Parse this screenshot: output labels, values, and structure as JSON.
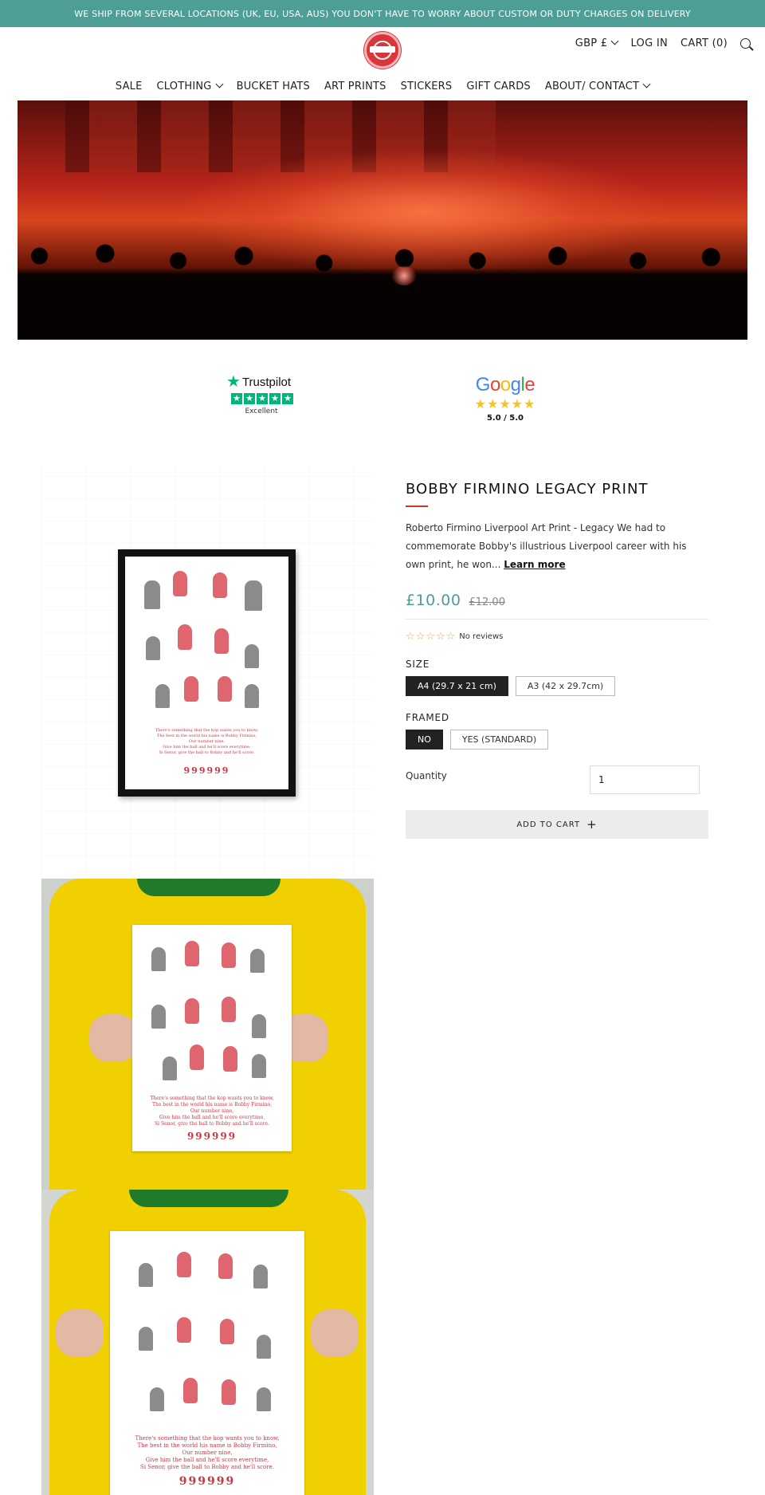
{
  "announcement": "WE SHIP FROM SEVERAL LOCATIONS (UK, EU, USA, AUS) YOU DON'T HAVE TO WORRY ABOUT CUSTOM OR DUTY CHARGES ON DELIVERY",
  "header": {
    "currency": "GBP £",
    "login": "LOG IN",
    "cart": "CART (0)"
  },
  "nav": {
    "items": [
      {
        "label": "SALE",
        "dropdown": false
      },
      {
        "label": "CLOTHING",
        "dropdown": true
      },
      {
        "label": "BUCKET HATS",
        "dropdown": false
      },
      {
        "label": "ART PRINTS",
        "dropdown": false
      },
      {
        "label": "STICKERS",
        "dropdown": false
      },
      {
        "label": "GIFT CARDS",
        "dropdown": false
      },
      {
        "label": "ABOUT/ CONTACT",
        "dropdown": true
      }
    ]
  },
  "badges": {
    "trustpilot": {
      "name": "Trustpilot",
      "rating_text": "Excellent",
      "stars": 5
    },
    "google": {
      "name": "Google",
      "score": "5.0 / 5.0",
      "stars": 5
    }
  },
  "gallery": {
    "poster_number": "999999",
    "poster_lines": [
      "There's something that the kop wants you to know,",
      "The best in the world his name is Bobby Firmino,",
      "Our number nine,",
      "Give him the ball and he'll score everytime,",
      "Si Senor, give the ball to Bobby and he'll score."
    ]
  },
  "product": {
    "title": "BOBBY FIRMINO LEGACY PRINT",
    "description": "Roberto Firmino Liverpool Art Print - Legacy We had to commemorate Bobby's illustrious Liverpool career with his own print, he won...",
    "learn_more": "Learn more",
    "price": "£10.00",
    "compare_price": "£12.00",
    "reviews_text": "No reviews",
    "size_label": "SIZE",
    "size_options": [
      "A4 (29.7 x 21 cm)",
      "A3 (42 x 29.7cm)"
    ],
    "size_selected": 0,
    "framed_label": "FRAMED",
    "framed_options": [
      "NO",
      "YES (STANDARD)"
    ],
    "framed_selected": 0,
    "quantity_label": "Quantity",
    "quantity_value": "1",
    "add_to_cart": "ADD TO CART"
  },
  "colors": {
    "accent": "#4d9f95",
    "brand_red": "#d8353c"
  }
}
